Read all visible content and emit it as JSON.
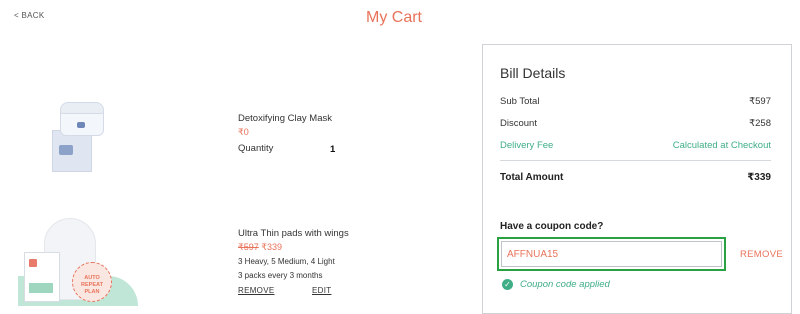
{
  "header": {
    "back_label": "< BACK",
    "title": "My Cart"
  },
  "cart": {
    "items": [
      {
        "name": "Detoxifying Clay Mask",
        "price": "₹0",
        "quantity_label": "Quantity",
        "quantity": "1"
      },
      {
        "name": "Ultra Thin pads with wings",
        "original_price": "₹597",
        "price": "₹339",
        "composition": "3 Heavy, 5 Medium, 4 Light",
        "schedule": "3 packs every 3 months",
        "remove_label": "REMOVE",
        "edit_label": "EDIT",
        "badge_text": "AUTO REPEAT PLAN"
      }
    ]
  },
  "bill": {
    "title": "Bill Details",
    "rows": [
      {
        "label": "Sub Total",
        "value": "₹597"
      },
      {
        "label": "Discount",
        "value": "₹258"
      },
      {
        "label": "Delivery Fee",
        "value": "Calculated at Checkout"
      }
    ],
    "total_label": "Total Amount",
    "total_value": "₹339"
  },
  "coupon": {
    "heading": "Have a coupon code?",
    "code": "AFFNUA15",
    "remove_label": "REMOVE",
    "status": "Coupon code applied"
  },
  "colors": {
    "accent": "#e8735a",
    "success": "#3fae86",
    "focus_border": "#2aa243"
  },
  "icons": {
    "applied": "check-circle-icon"
  }
}
